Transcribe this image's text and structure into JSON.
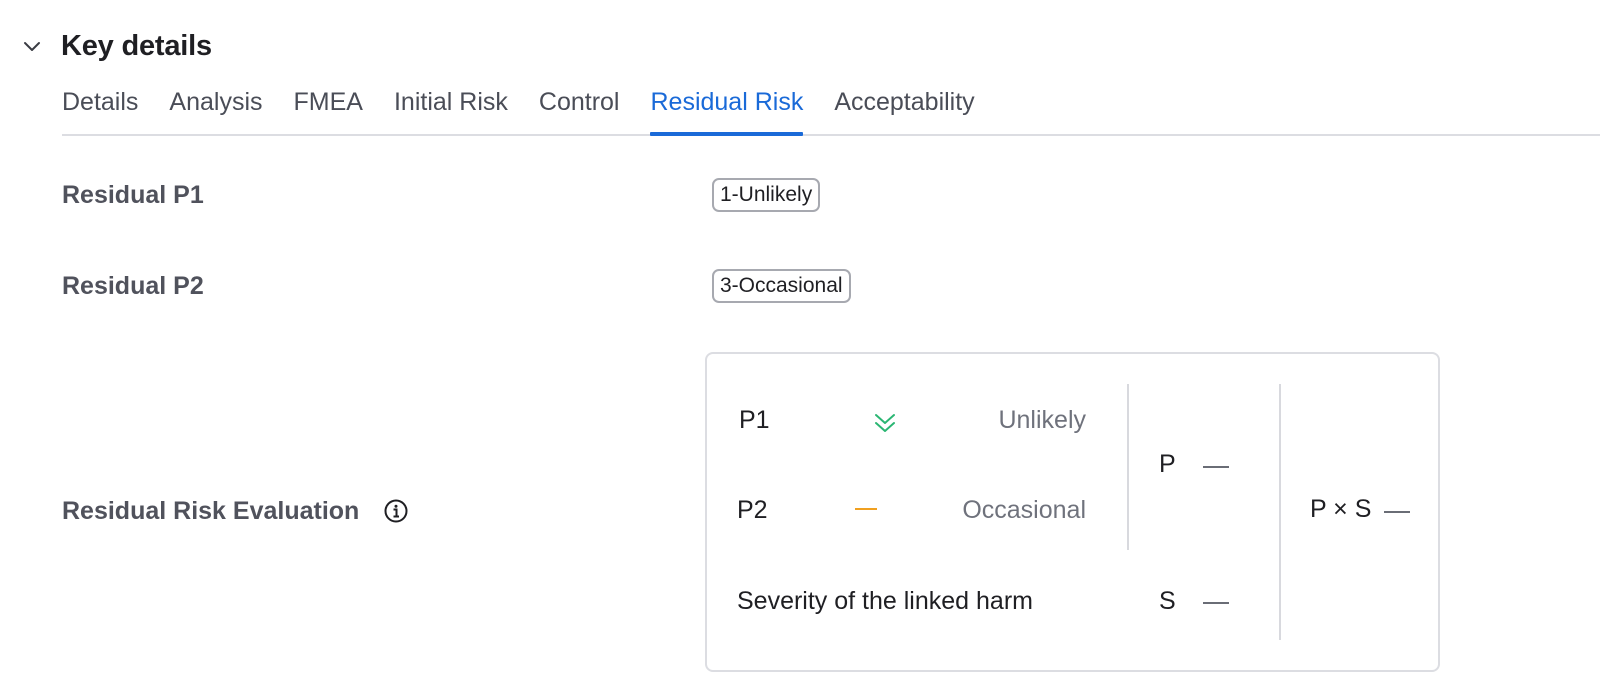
{
  "section": {
    "title": "Key details"
  },
  "tabs": [
    {
      "label": "Details"
    },
    {
      "label": "Analysis"
    },
    {
      "label": "FMEA"
    },
    {
      "label": "Initial Risk"
    },
    {
      "label": "Control"
    },
    {
      "label": "Residual Risk"
    },
    {
      "label": "Acceptability"
    }
  ],
  "active_tab": "Residual Risk",
  "fields": {
    "residual_p1": {
      "label": "Residual P1",
      "value": "1-Unlikely"
    },
    "residual_p2": {
      "label": "Residual P2",
      "value": "3-Occasional"
    },
    "evaluation": {
      "label": "Residual Risk Evaluation"
    }
  },
  "evaluation": {
    "p1": {
      "label": "P1",
      "level": "Unlikely",
      "icon": "double-chevron-down-icon",
      "icon_color": "#2bb673"
    },
    "p2": {
      "label": "P2",
      "level": "Occasional",
      "icon": "dash-icon",
      "icon_color": "#f0a020"
    },
    "severity": {
      "label": "Severity of the linked harm"
    },
    "p_label": "P",
    "s_label": "S",
    "pxs_label": "P × S"
  },
  "colors": {
    "accent": "#1a6ad8"
  }
}
